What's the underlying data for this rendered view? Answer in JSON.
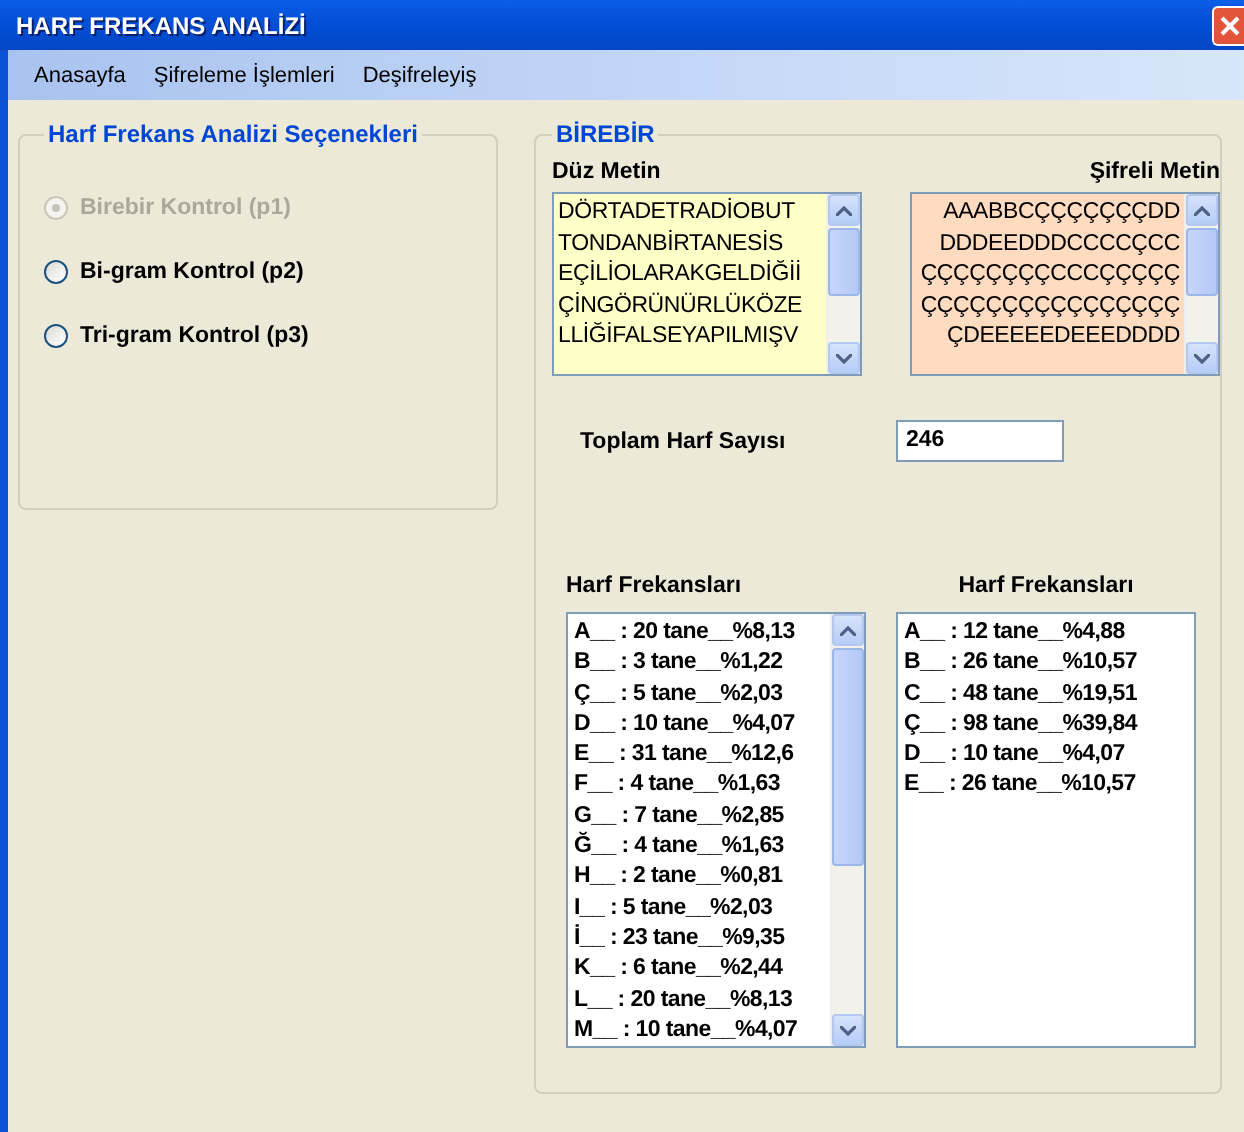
{
  "window": {
    "title": "HARF FREKANS ANALİZİ"
  },
  "menu": [
    "Anasayfa",
    "Şifreleme İşlemleri",
    "Deşifreleyiş"
  ],
  "options_group": {
    "title": "Harf Frekans Analizi Seçenekleri",
    "options": [
      {
        "label": "Birebir Kontrol (p1)",
        "selected": true,
        "disabled": true
      },
      {
        "label": "Bi-gram Kontrol (p2)",
        "selected": false,
        "disabled": false
      },
      {
        "label": "Tri-gram Kontrol (p3)",
        "selected": false,
        "disabled": false
      }
    ]
  },
  "result_group": {
    "title": "BİREBİR",
    "plain_text": {
      "label": "Düz Metin",
      "lines": [
        "DÖRTADETRADİOBUT",
        "TONDANBİRTANESİS",
        "EÇİLİOLARAKGELDİĞİİ",
        "ÇİNGÖRÜNÜRLÜKÖZE",
        "LLİĞİFALSEYAPILMIŞV"
      ]
    },
    "cipher_text": {
      "label": "Şifreli Metin",
      "lines": [
        "AAABBCÇÇÇÇÇÇÇDD",
        "DDDEEDDDCCCCÇCC",
        "ÇÇÇÇÇÇÇÇCCCÇÇÇÇÇ",
        "ÇÇÇÇÇÇÇÇÇÇÇÇÇÇÇÇ",
        "ÇDEEEEEDEEEDDDD"
      ]
    },
    "total": {
      "label": "Toplam Harf Sayısı",
      "value": "246"
    },
    "plain_freq": {
      "label": "Harf Frekansları",
      "items": [
        "A__ : 20 tane__%8,13",
        "B__ : 3 tane__%1,22",
        "Ç__ : 5 tane__%2,03",
        "D__ : 10 tane__%4,07",
        "E__ : 31 tane__%12,6",
        "F__ : 4 tane__%1,63",
        "G__ : 7 tane__%2,85",
        "Ğ__ : 4 tane__%1,63",
        "H__ : 2 tane__%0,81",
        "I__ : 5 tane__%2,03",
        "İ__ : 23 tane__%9,35",
        "K__ : 6 tane__%2,44",
        "L__ : 20 tane__%8,13",
        "M__ : 10 tane__%4,07"
      ]
    },
    "cipher_freq": {
      "label": "Harf Frekansları",
      "items": [
        "A__ : 12 tane__%4,88",
        "B__ : 26 tane__%10,57",
        "C__ : 48 tane__%19,51",
        "Ç__ : 98 tane__%39,84",
        "D__ : 10 tane__%4,07",
        "E__ : 26 tane__%10,57"
      ]
    }
  }
}
